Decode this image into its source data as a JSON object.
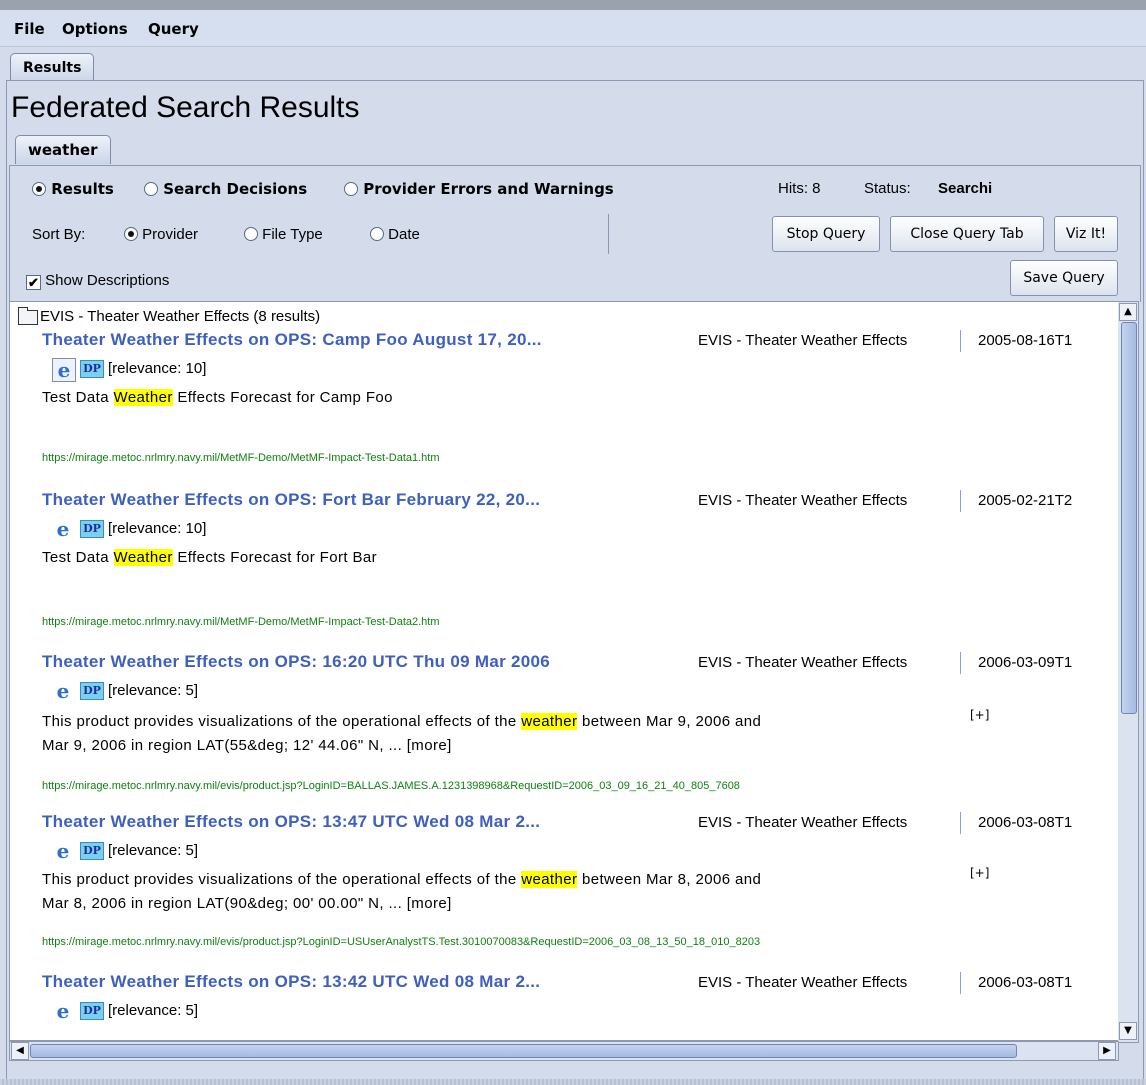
{
  "menu": [
    "File",
    "Options",
    "Query"
  ],
  "outer_tab": "Results",
  "page_title": "Federated Search Results",
  "query_tab": "weather",
  "view_options": [
    "Results",
    "Search Decisions",
    "Provider Errors and Warnings"
  ],
  "view_selected": "Results",
  "hits": "Hits: 8",
  "status_label": "Status:",
  "status_value": "Searchi",
  "sort_label": "Sort By:",
  "sort_options": [
    "Provider",
    "File Type",
    "Date"
  ],
  "sort_selected": "Provider",
  "buttons": {
    "stop": "Stop Query",
    "close": "Close Query Tab",
    "viz": "Viz It!",
    "save": "Save Query"
  },
  "show_descriptions": {
    "label": "Show Descriptions",
    "checked": true
  },
  "group": {
    "label": "EVIS - Theater Weather Effects (8 results)"
  },
  "results": [
    {
      "title": "Theater Weather Effects on OPS: Camp Foo August 17, 20...",
      "provider": "EVIS - Theater Weather Effects",
      "date": "2005-08-16T1",
      "relevance": "[relevance: 10]",
      "desc_before": "Test Data ",
      "desc_highlight": "Weather",
      "desc_after": " Effects Forecast for Camp Foo",
      "desc_line2": "",
      "expand": "",
      "url": "https://mirage.metoc.nrlmry.navy.mil/MetMF-Demo/MetMF-Impact-Test-Data1.htm"
    },
    {
      "title": "Theater Weather Effects on OPS: Fort Bar February 22, 20...",
      "provider": "EVIS - Theater Weather Effects",
      "date": "2005-02-21T2",
      "relevance": "[relevance: 10]",
      "desc_before": "Test Data ",
      "desc_highlight": "Weather",
      "desc_after": " Effects Forecast for Fort Bar",
      "desc_line2": "",
      "expand": "",
      "url": "https://mirage.metoc.nrlmry.navy.mil/MetMF-Demo/MetMF-Impact-Test-Data2.htm"
    },
    {
      "title": "Theater Weather Effects on OPS: 16:20 UTC Thu 09 Mar 2006",
      "provider": "EVIS - Theater Weather Effects",
      "date": "2006-03-09T1",
      "relevance": "[relevance: 5]",
      "desc_before": "This product provides visualizations of the operational effects of the ",
      "desc_highlight": "weather",
      "desc_after": " between Mar 9, 2006 and",
      "desc_line2": "Mar 9, 2006 in region LAT(55&deg; 12' 44.06\" N,  ... [more]",
      "expand": "[+]",
      "url": "https://mirage.metoc.nrlmry.navy.mil/evis/product.jsp?LoginID=BALLAS.JAMES.A.1231398968&RequestID=2006_03_09_16_21_40_805_7608"
    },
    {
      "title": "Theater Weather Effects on OPS: 13:47 UTC Wed 08 Mar 2...",
      "provider": "EVIS - Theater Weather Effects",
      "date": "2006-03-08T1",
      "relevance": "[relevance: 5]",
      "desc_before": "This product provides visualizations of the operational effects of the ",
      "desc_highlight": "weather",
      "desc_after": " between Mar 8, 2006 and",
      "desc_line2": "Mar 8, 2006 in region LAT(90&deg; 00' 00.00\" N,  ... [more]",
      "expand": "[+]",
      "url": "https://mirage.metoc.nrlmry.navy.mil/evis/product.jsp?LoginID=USUserAnalystTS.Test.3010070083&RequestID=2006_03_08_13_50_18_010_8203"
    },
    {
      "title": "Theater Weather Effects on OPS: 13:42 UTC Wed 08 Mar 2...",
      "provider": "EVIS - Theater Weather Effects",
      "date": "2006-03-08T1",
      "relevance": "[relevance: 5]"
    }
  ],
  "icons": {
    "browser": "internet-explorer-icon",
    "dp": "DP",
    "folder": "folder-icon"
  }
}
